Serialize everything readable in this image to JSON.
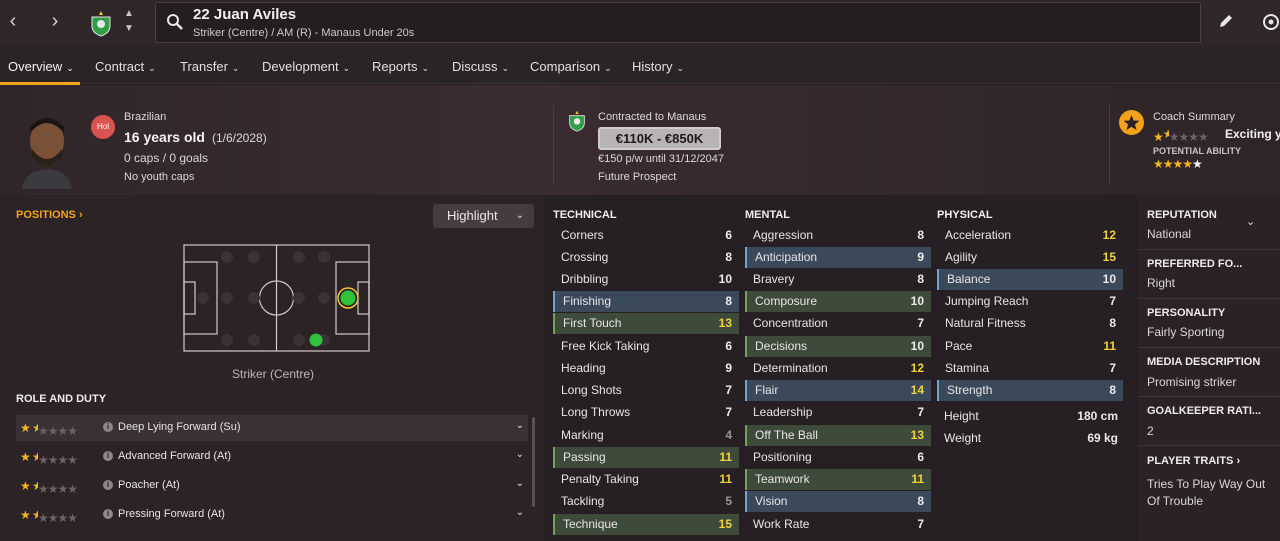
{
  "header": {
    "player_name": "22 Juan Aviles",
    "player_sub": "Striker (Centre) / AM (R) - Manaus Under 20s"
  },
  "tabs": [
    {
      "label": "Overview"
    },
    {
      "label": "Contract"
    },
    {
      "label": "Transfer"
    },
    {
      "label": "Development"
    },
    {
      "label": "Reports"
    },
    {
      "label": "Discuss"
    },
    {
      "label": "Comparison"
    },
    {
      "label": "History"
    }
  ],
  "profile": {
    "nationality": "Brazilian",
    "badge": "Hol",
    "age": "16 years old",
    "dob": "(1/6/2028)",
    "caps": "0 caps / 0 goals",
    "youth_caps": "No youth caps",
    "contract_label": "Contracted to Manaus",
    "value_range": "€110K - €850K",
    "wage": "€150 p/w until 31/12/2047",
    "status": "Future Prospect",
    "coach_summary_label": "Coach Summary",
    "coach_summary_text": "Exciting y",
    "current_ability_stars": 1.5,
    "potential_label": "POTENTIAL ABILITY",
    "potential_ability_stars": 4.5
  },
  "positions": {
    "title": "POSITIONS",
    "highlight_label": "Highlight",
    "position_label": "Striker (Centre)",
    "role_duty_title": "ROLE AND DUTY",
    "roles": [
      {
        "name": "Deep Lying Forward (Su)",
        "stars": 1.5
      },
      {
        "name": "Advanced Forward (At)",
        "stars": 1.5
      },
      {
        "name": "Poacher (At)",
        "stars": 1.5
      },
      {
        "name": "Pressing Forward (At)",
        "stars": 1.5
      }
    ]
  },
  "attributes": {
    "technical_title": "TECHNICAL",
    "mental_title": "MENTAL",
    "physical_title": "PHYSICAL",
    "technical": [
      {
        "name": "Corners",
        "value": "6"
      },
      {
        "name": "Crossing",
        "value": "8"
      },
      {
        "name": "Dribbling",
        "value": "10"
      },
      {
        "name": "Finishing",
        "value": "8"
      },
      {
        "name": "First Touch",
        "value": "13"
      },
      {
        "name": "Free Kick Taking",
        "value": "6"
      },
      {
        "name": "Heading",
        "value": "9"
      },
      {
        "name": "Long Shots",
        "value": "7"
      },
      {
        "name": "Long Throws",
        "value": "7"
      },
      {
        "name": "Marking",
        "value": "4"
      },
      {
        "name": "Passing",
        "value": "11"
      },
      {
        "name": "Penalty Taking",
        "value": "11"
      },
      {
        "name": "Tackling",
        "value": "5"
      },
      {
        "name": "Technique",
        "value": "15"
      }
    ],
    "mental": [
      {
        "name": "Aggression",
        "value": "8"
      },
      {
        "name": "Anticipation",
        "value": "9"
      },
      {
        "name": "Bravery",
        "value": "8"
      },
      {
        "name": "Composure",
        "value": "10"
      },
      {
        "name": "Concentration",
        "value": "7"
      },
      {
        "name": "Decisions",
        "value": "10"
      },
      {
        "name": "Determination",
        "value": "12"
      },
      {
        "name": "Flair",
        "value": "14"
      },
      {
        "name": "Leadership",
        "value": "7"
      },
      {
        "name": "Off The Ball",
        "value": "13"
      },
      {
        "name": "Positioning",
        "value": "6"
      },
      {
        "name": "Teamwork",
        "value": "11"
      },
      {
        "name": "Vision",
        "value": "8"
      },
      {
        "name": "Work Rate",
        "value": "7"
      }
    ],
    "physical": [
      {
        "name": "Acceleration",
        "value": "12"
      },
      {
        "name": "Agility",
        "value": "15"
      },
      {
        "name": "Balance",
        "value": "10"
      },
      {
        "name": "Jumping Reach",
        "value": "7"
      },
      {
        "name": "Natural Fitness",
        "value": "8"
      },
      {
        "name": "Pace",
        "value": "11"
      },
      {
        "name": "Stamina",
        "value": "7"
      },
      {
        "name": "Strength",
        "value": "8"
      }
    ],
    "height_label": "Height",
    "height_value": "180 cm",
    "weight_label": "Weight",
    "weight_value": "69 kg"
  },
  "side": {
    "reputation_label": "REPUTATION",
    "reputation_value": "National",
    "foot_label": "PREFERRED FO...",
    "foot_value": "Right",
    "personality_label": "PERSONALITY",
    "personality_value": "Fairly Sporting",
    "media_label": "MEDIA DESCRIPTION",
    "media_value": "Promising striker",
    "gk_label": "GOALKEEPER RATI...",
    "gk_value": "2",
    "traits_label": "PLAYER TRAITS",
    "traits_value": "Tries To Play Way Out Of Trouble"
  },
  "colors": {
    "accent": "#f2a21b",
    "high_value": "#f0d33a",
    "low_value": "#9a9497",
    "position_natural": "#2fc23a"
  }
}
